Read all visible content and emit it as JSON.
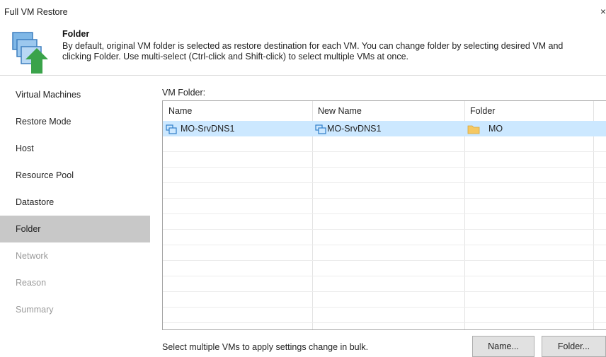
{
  "window": {
    "title": "Full VM Restore",
    "close_label": "×"
  },
  "header": {
    "title": "Folder",
    "desc_line1": "By default, original VM folder is selected as restore destination for each VM. You can change folder by selecting desired VM and",
    "desc_line2": "clicking Folder. Use multi-select (Ctrl-click and Shift-click) to select multiple VMs at once."
  },
  "nav": {
    "items": [
      {
        "label": "Virtual Machines",
        "state": "normal"
      },
      {
        "label": "Restore Mode",
        "state": "normal"
      },
      {
        "label": "Host",
        "state": "normal"
      },
      {
        "label": "Resource Pool",
        "state": "normal"
      },
      {
        "label": "Datastore",
        "state": "normal"
      },
      {
        "label": "Folder",
        "state": "active"
      },
      {
        "label": "Network",
        "state": "disabled"
      },
      {
        "label": "Reason",
        "state": "disabled"
      },
      {
        "label": "Summary",
        "state": "disabled"
      }
    ]
  },
  "main": {
    "section_label": "VM Folder:",
    "columns": [
      "Name",
      "New Name",
      "Folder"
    ],
    "rows": [
      {
        "name": "MO-SrvDNS1",
        "new_name": "MO-SrvDNS1",
        "folder": "MO",
        "selected": true
      }
    ],
    "hint": "Select multiple VMs to apply settings change in bulk.",
    "buttons": {
      "name": "Name...",
      "folder": "Folder..."
    }
  },
  "colors": {
    "selection": "#cce8ff",
    "active_nav": "#c8c8c8",
    "folder": "#f5c862",
    "vm_icon": "#2f7fc9",
    "accent_arrow": "#3aa34a"
  }
}
